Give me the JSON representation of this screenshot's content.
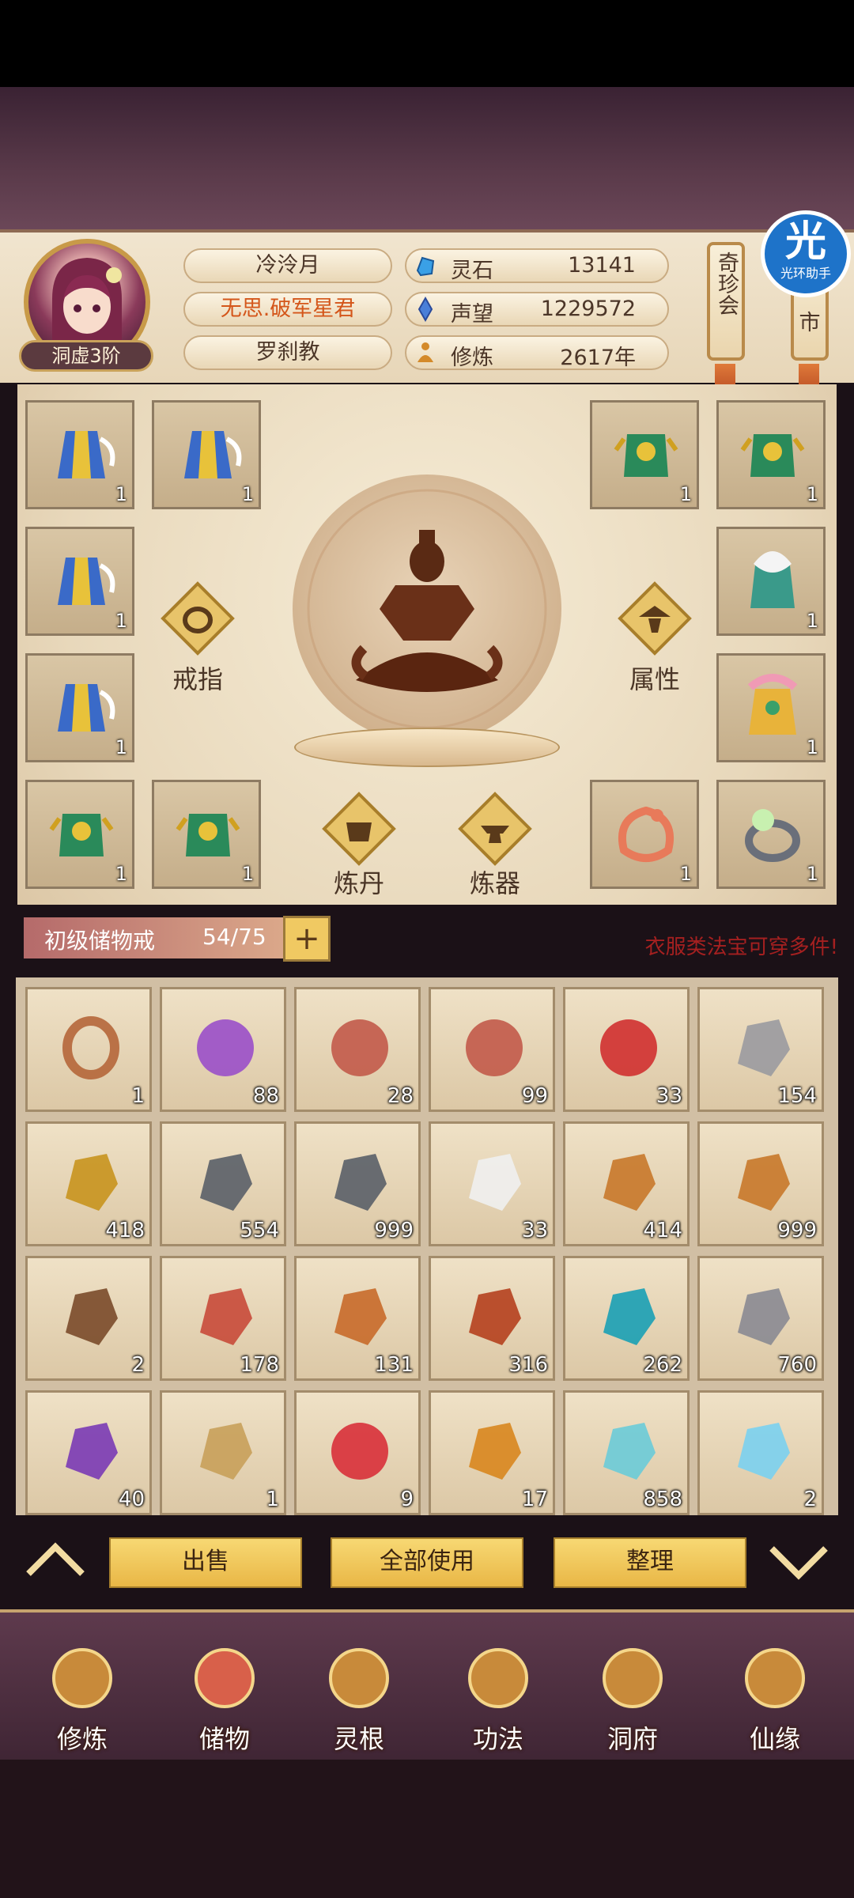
{
  "player": {
    "realm": "洞虚3阶",
    "name": "冷泠月",
    "title": "无思.破军星君",
    "sect": "罗刹教"
  },
  "stats": [
    {
      "label": "灵石",
      "value": "13141",
      "icon": "spirit-stone-icon",
      "color": "#3aa0e6"
    },
    {
      "label": "声望",
      "value": "1229572",
      "icon": "prestige-crystal-icon",
      "color": "#4a7fd8"
    },
    {
      "label": "修炼",
      "value": "2617年",
      "icon": "cultivation-figure-icon",
      "color": "#d48a2a"
    }
  ],
  "side_menu": {
    "treasure_pavilion": "奇珍会",
    "market": "市"
  },
  "assist_badge": {
    "glyph": "光",
    "text": "光环助手"
  },
  "equip_labels": {
    "ring": "戒指",
    "attributes": "属性",
    "alchemy": "炼丹",
    "forging": "炼器"
  },
  "equip_slots": [
    {
      "count": "1",
      "icon": "blue-winged-robe-icon"
    },
    {
      "count": "1",
      "icon": "blue-winged-robe-icon"
    },
    {
      "count": "1",
      "icon": "blue-winged-robe-icon"
    },
    {
      "count": "1",
      "icon": "blue-winged-robe-icon"
    },
    {
      "count": "1",
      "icon": "jade-armor-icon"
    },
    {
      "count": "1",
      "icon": "jade-armor-icon"
    },
    {
      "count": "1",
      "icon": "jade-armor-icon"
    },
    {
      "count": "1",
      "icon": "jade-armor-icon"
    },
    {
      "count": "1",
      "icon": "fur-collar-robe-icon"
    },
    {
      "count": "1",
      "icon": "golden-pink-robe-icon"
    },
    {
      "count": "1",
      "icon": "dragon-pendant-icon"
    },
    {
      "count": "1",
      "icon": "pearl-ring-icon"
    }
  ],
  "storage": {
    "name": "初级储物戒",
    "capacity": "54/75",
    "add": "+",
    "note": "衣服类法宝可穿多件!"
  },
  "inventory": [
    {
      "count": "1",
      "icon": "wooden-ring-icon",
      "color": "#b5663a"
    },
    {
      "count": "88",
      "icon": "purple-orb-icon",
      "color": "#9a4fc9"
    },
    {
      "count": "28",
      "icon": "red-orb-icon",
      "color": "#c25a4a"
    },
    {
      "count": "99",
      "icon": "red-orb-icon",
      "color": "#c25a4a"
    },
    {
      "count": "33",
      "icon": "red-orb-pedestal-icon",
      "color": "#d03030"
    },
    {
      "count": "154",
      "icon": "silver-ore-icon",
      "color": "#9a9aa0"
    },
    {
      "count": "418",
      "icon": "gold-ore-icon",
      "color": "#c8941e"
    },
    {
      "count": "554",
      "icon": "iron-ore-icon",
      "color": "#5a5f68"
    },
    {
      "count": "999",
      "icon": "iron-ore-icon",
      "color": "#5a5f68"
    },
    {
      "count": "33",
      "icon": "white-lily-icon",
      "color": "#f0f0f0"
    },
    {
      "count": "414",
      "icon": "ginseng-root-icon",
      "color": "#c8782a"
    },
    {
      "count": "999",
      "icon": "ginseng-root-icon",
      "color": "#c8782a"
    },
    {
      "count": "2",
      "icon": "herb-root-icon",
      "color": "#7a4a2a"
    },
    {
      "count": "178",
      "icon": "red-flower-herb-icon",
      "color": "#c84a3a"
    },
    {
      "count": "131",
      "icon": "caterpillar-fungus-icon",
      "color": "#c86a2a"
    },
    {
      "count": "316",
      "icon": "red-crystal-ore-icon",
      "color": "#b5401e"
    },
    {
      "count": "262",
      "icon": "cyan-crystal-icon",
      "color": "#1aa0b5"
    },
    {
      "count": "760",
      "icon": "grey-stone-icon",
      "color": "#8a8a92"
    },
    {
      "count": "40",
      "icon": "purple-berry-branch-icon",
      "color": "#7a3ab5"
    },
    {
      "count": "1",
      "icon": "scroll-bundle-icon",
      "color": "#c8a05a"
    },
    {
      "count": "9",
      "icon": "crimson-orb-icon",
      "color": "#d8303a"
    },
    {
      "count": "17",
      "icon": "gourd-icon",
      "color": "#d8861e"
    },
    {
      "count": "858",
      "icon": "elixir-bottle-icon",
      "color": "#6acbd8"
    },
    {
      "count": "2",
      "icon": "spirit-bowl-icon",
      "color": "#7ad0f0"
    }
  ],
  "actions": {
    "sell": "出售",
    "use_all": "全部使用",
    "sort": "整理"
  },
  "bottom_nav": [
    {
      "label": "修炼",
      "icon": "cultivation-monk-icon"
    },
    {
      "label": "储物",
      "icon": "storage-bag-icon"
    },
    {
      "label": "灵根",
      "icon": "spirit-root-icon"
    },
    {
      "label": "功法",
      "icon": "technique-book-icon"
    },
    {
      "label": "洞府",
      "icon": "cave-mansion-icon"
    },
    {
      "label": "仙缘",
      "icon": "immortal-fate-icon"
    }
  ]
}
